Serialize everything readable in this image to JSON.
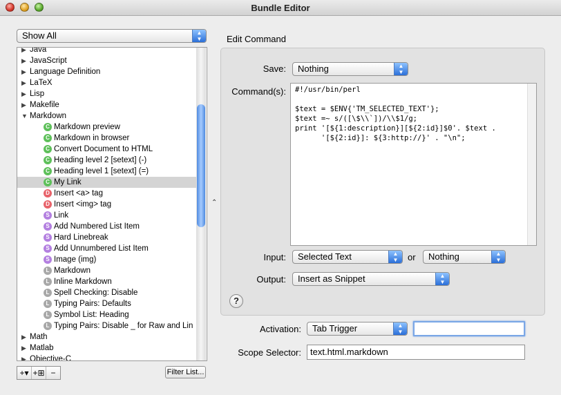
{
  "window": {
    "title": "Bundle Editor"
  },
  "filter": {
    "selected": "Show All"
  },
  "tree": {
    "rows": [
      {
        "kind": "cat",
        "label": "Java",
        "expanded": false
      },
      {
        "kind": "cat",
        "label": "JavaScript",
        "expanded": false
      },
      {
        "kind": "cat",
        "label": "Language Definition",
        "expanded": false
      },
      {
        "kind": "cat",
        "label": "LaTeX",
        "expanded": false
      },
      {
        "kind": "cat",
        "label": "Lisp",
        "expanded": false
      },
      {
        "kind": "cat",
        "label": "Makefile",
        "expanded": false
      },
      {
        "kind": "cat",
        "label": "Markdown",
        "expanded": true
      },
      {
        "kind": "item",
        "badge": "C",
        "label": "Markdown preview"
      },
      {
        "kind": "item",
        "badge": "C",
        "label": "Markdown in browser"
      },
      {
        "kind": "item",
        "badge": "C",
        "label": "Convert Document to HTML"
      },
      {
        "kind": "item",
        "badge": "C",
        "label": "Heading level 2 [setext] (-)"
      },
      {
        "kind": "item",
        "badge": "C",
        "label": "Heading level 1 [setext] (=)"
      },
      {
        "kind": "item",
        "badge": "C",
        "label": "My Link",
        "selected": true
      },
      {
        "kind": "item",
        "badge": "D",
        "label": "Insert <a> tag"
      },
      {
        "kind": "item",
        "badge": "D",
        "label": "Insert <img> tag"
      },
      {
        "kind": "item",
        "badge": "S",
        "label": "Link"
      },
      {
        "kind": "item",
        "badge": "S",
        "label": "Add Numbered List Item"
      },
      {
        "kind": "item",
        "badge": "S",
        "label": "Hard Linebreak"
      },
      {
        "kind": "item",
        "badge": "S",
        "label": "Add Unnumbered List Item"
      },
      {
        "kind": "item",
        "badge": "S",
        "label": "Image (img)"
      },
      {
        "kind": "item",
        "badge": "L",
        "label": "Markdown"
      },
      {
        "kind": "item",
        "badge": "L",
        "label": "Inline Markdown"
      },
      {
        "kind": "item",
        "badge": "L",
        "label": "Spell Checking: Disable"
      },
      {
        "kind": "item",
        "badge": "L",
        "label": "Typing Pairs: Defaults"
      },
      {
        "kind": "item",
        "badge": "L",
        "label": "Symbol List: Heading"
      },
      {
        "kind": "item",
        "badge": "L",
        "label": "Typing Pairs: Disable _ for Raw and Lin"
      },
      {
        "kind": "cat",
        "label": "Math",
        "expanded": false
      },
      {
        "kind": "cat",
        "label": "Matlab",
        "expanded": false
      },
      {
        "kind": "cat",
        "label": "Objective-C",
        "expanded": false
      }
    ]
  },
  "bottom_bar": {
    "add_label": "+▾",
    "add_item_label": "+⊞",
    "remove_label": "−",
    "filter_list_label": "Filter List..."
  },
  "editor": {
    "section_title": "Edit Command",
    "save_label": "Save:",
    "save_value": "Nothing",
    "command_label": "Command(s):",
    "command_text": "#!/usr/bin/perl\n\n$text = $ENV{'TM_SELECTED_TEXT'};\n$text =~ s/([\\$\\\\`])/\\\\$1/g;\nprint '[${1:description}][${2:id}]$0'. $text .\n      '[${2:id}]: ${3:http://}' . \"\\n\";",
    "input_label": "Input:",
    "input_value": "Selected Text",
    "or_label": "or",
    "input_fallback": "Nothing",
    "output_label": "Output:",
    "output_value": "Insert as Snippet",
    "help_label": "?"
  },
  "activation": {
    "label": "Activation:",
    "value": "Tab Trigger",
    "trigger_text": ""
  },
  "scope": {
    "label": "Scope Selector:",
    "value": "text.html.markdown"
  },
  "colors": {
    "accent_blue": "#2b6fd8",
    "command_badge": "#5ec05a",
    "drag_badge": "#e8626a",
    "snippet_badge": "#b37fe0",
    "language_badge": "#a8a8a8"
  }
}
